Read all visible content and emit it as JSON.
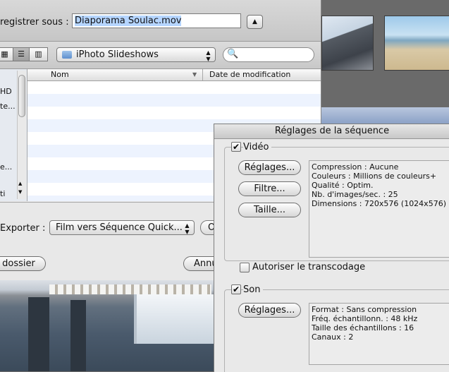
{
  "save_dialog": {
    "save_label": "registrer sous :",
    "filename": "Diaporama Soulac.mov",
    "expand_symbol": "▲",
    "view_icon_symbol": "▦",
    "view_list_symbol": "☰",
    "view_columns_symbol": "▥",
    "location": "iPhoto Slideshows",
    "popup_arrow_symbol": "▲▼",
    "search_symbol": "🔍",
    "sidebar_items": [
      "HD",
      "te...",
      "",
      "",
      "",
      "e...",
      "",
      "ti"
    ],
    "columns": {
      "name": "Nom",
      "sort_symbol": "▼",
      "date": "Date de modification"
    },
    "export_label": "Exporter :",
    "export_value": "Film vers Séquence Quick...",
    "options_label": "O",
    "new_folder_label": "dossier",
    "cancel_label": "Annu"
  },
  "sequence_settings": {
    "title": "Réglages de la séquence",
    "video": {
      "label": "Vidéo",
      "checked": true,
      "settings_button": "Réglages...",
      "filter_button": "Filtre...",
      "size_button": "Taille...",
      "info": [
        "Compression : Aucune",
        "Couleurs : Millions de couleurs+",
        "Qualité : Optim.",
        "Nb. d'images/sec. : 25",
        "Dimensions : 720x576 (1024x576)"
      ],
      "transcode_label": "Autoriser le transcodage",
      "transcode_checked": false
    },
    "sound": {
      "label": "Son",
      "checked": true,
      "settings_button": "Réglages...",
      "info": [
        "Format : Sans compression",
        "Fréq. échantillonn. : 48 kHz",
        "Taille des échantillons : 16",
        "Canaux : 2"
      ]
    },
    "check_mark": "✔"
  }
}
